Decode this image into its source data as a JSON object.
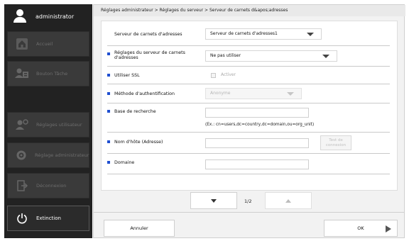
{
  "sidebar": {
    "user_name": "administrator",
    "items": [
      {
        "label": "Accueil",
        "icon": "home-icon",
        "enabled": false
      },
      {
        "label": "Bouton Tâche",
        "icon": "task-button-icon",
        "enabled": false
      },
      {
        "label": "Réglages utilisateur",
        "icon": "user-settings-icon",
        "enabled": false
      },
      {
        "label": "Réglage administrateur",
        "icon": "admin-settings-icon",
        "enabled": false
      },
      {
        "label": "Déconnexion",
        "icon": "logout-icon",
        "enabled": false
      },
      {
        "label": "Extinction",
        "icon": "power-icon",
        "enabled": true
      }
    ]
  },
  "breadcrumb": "Réglages administrateur > Réglages du serveur > Serveur de carnets d&apos;adresses",
  "form": {
    "server_label": "Serveur de carnets d'adresses",
    "server_value": "Serveur de carnets d'adresses1",
    "settings_label": "Réglages du serveur de carnets d'adresses",
    "settings_value": "Ne pas utiliser",
    "ssl_label": "Utiliser SSL",
    "ssl_option": "Activer",
    "ssl_checked": false,
    "auth_label": "Méthode d'authentification",
    "auth_value": "Anonyme",
    "search_base_label": "Base de recherche",
    "search_base_value": "",
    "search_base_hint": "(Ex.: cn=users,dc=country,dc=domain,ou=org_unit)",
    "host_label": "Nom d'hôte (Adresse)",
    "host_value": "",
    "test_button": "Test de connexion",
    "domain_label": "Domaine",
    "domain_value": ""
  },
  "pager": {
    "page": "1/2"
  },
  "footer": {
    "cancel": "Annuler",
    "ok": "OK"
  },
  "colors": {
    "accent_bullet": "#1f4fd1",
    "sidebar_bg": "#222222"
  }
}
